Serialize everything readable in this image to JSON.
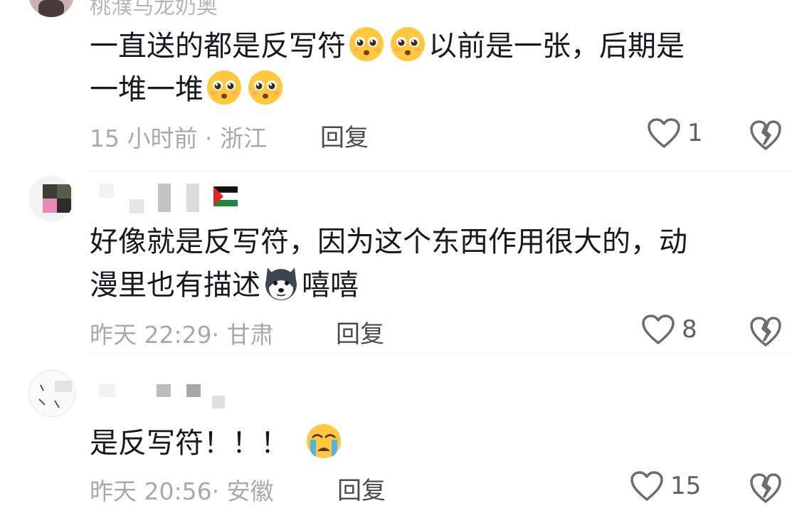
{
  "comments": [
    {
      "username": "桃濮马龙奶奥",
      "text_part1": "一直送的都是反写符",
      "text_part2": "以前是一张，后期是",
      "text_part3": "一堆一堆",
      "time": "15 小时前",
      "location": "浙江",
      "reply_label": "回复",
      "likes": "1",
      "emojis": [
        "pleading-face-emoji",
        "pleading-face-emoji",
        "pleading-face-emoji",
        "pleading-face-emoji"
      ]
    },
    {
      "username": "",
      "text_part1": "好像就是反写符，因为这个东西作用很大的，动",
      "text_part2": "漫里也有描述",
      "text_part3": "嘻嘻",
      "time": "昨天 22:29",
      "location": "甘肃",
      "reply_label": "回复",
      "likes": "8",
      "emojis": [
        "husky-dog-emoji"
      ]
    },
    {
      "username": "",
      "text_part1": "是反写符！！！",
      "time": "昨天 20:56",
      "location": "安徽",
      "reply_label": "回复",
      "likes": "15",
      "emojis": [
        "crying-face-emoji"
      ]
    }
  ],
  "separator": "·",
  "colors": {
    "text_primary": "#161823",
    "text_secondary": "#a8a9ad",
    "emoji_yellow": "#ffc83d"
  }
}
